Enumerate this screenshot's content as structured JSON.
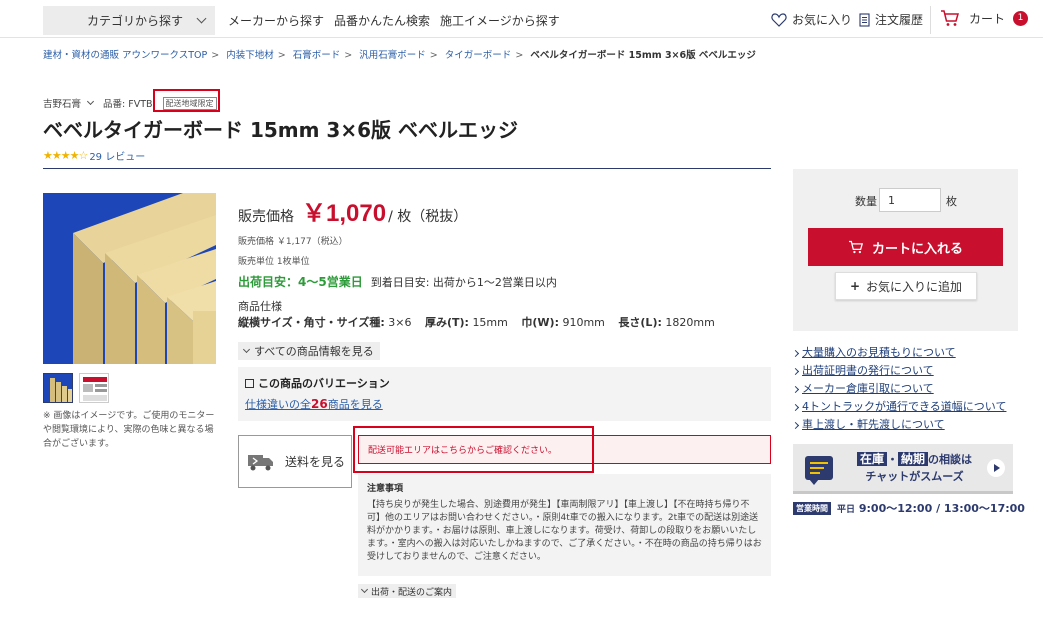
{
  "header": {
    "category_button": "カテゴリから探す",
    "nav": [
      "メーカーから探す",
      "品番かんたん検索",
      "施工イメージから探す"
    ],
    "favorites": "お気に入り",
    "order_history": "注文履歴",
    "cart": "カート",
    "cart_count": "1"
  },
  "breadcrumb": {
    "items": [
      "建材・資材の通販 アウンワークスTOP",
      "内装下地材",
      "石膏ボード",
      "汎用石膏ボード",
      "タイガーボード"
    ],
    "current": "ベベルタイガーボード 15mm 3×6版 ベベルエッジ"
  },
  "product": {
    "maker": "吉野石膏",
    "part_number": "品番: FVTB",
    "limit_tag": "配送地域限定",
    "title": "ベベルタイガーボード 15mm 3×6版 ベベルエッジ",
    "stars": "★★★★☆",
    "rating_value": 4.5,
    "reviews": "29 レビュー",
    "image_note": "※ 画像はイメージです。ご使用のモニターや閲覧環境により、実際の色味と異なる場合がございます。"
  },
  "price": {
    "label": "販売価格",
    "value": "￥1,070",
    "unit": "/ 枚（税抜）",
    "tax_included": "販売価格 ￥1,177（税込）",
    "sales_unit": "販売単位 1枚単位",
    "ship_estimate": "出荷目安：4〜5営業日",
    "arrival_estimate": "到着日目安: 出荷から1〜2営業日以内"
  },
  "spec": {
    "title": "商品仕様",
    "k1": "縦横サイズ・角寸・サイズ種:",
    "v1": "3×6",
    "k2": "厚み(T):",
    "v2": "15mm",
    "k3": "巾(W):",
    "v3": "910mm",
    "k4": "長さ(L):",
    "v4": "1820mm"
  },
  "all_info_button": "すべての商品情報を見る",
  "variation": {
    "title": "この商品のバリエーション",
    "link_prefix": "仕様違いの全",
    "link_count": "26",
    "link_suffix": "商品を見る"
  },
  "shipping_cost_button": "送料を見る",
  "area_notice": "配送可能エリアはこちらからご確認ください。",
  "caution": {
    "title": "注意事項",
    "text": "【持ち戻りが発生した場合、別途費用が発生】【車両制限アリ】【車上渡し】【不在時持ち帰り不可】他のエリアはお問い合わせください。・原則4t車での搬入になります。2t車での配送は別途送料がかかります。・お届けは原則、車上渡しになります。荷受け、荷卸しの段取りをお願いいたします。・室内への搬入は対応いたしかねますので、ご了承ください。・不在時の商品の持ち帰りはお受けしておりませんので、ご注意ください。"
  },
  "ship_guide_button": "出荷・配送のご案内",
  "cart_panel": {
    "qty_label": "数量",
    "qty_value": "1",
    "qty_unit": "枚",
    "add_to_cart": "カートに入れる",
    "add_favorite": "お気に入りに追加"
  },
  "side_links": [
    "大量購入のお見積もりについて",
    "出荷証明書の発行について",
    "メーカー倉庫引取について",
    "4トントラックが通行できる道幅について",
    "車上渡し・軒先渡しについて"
  ],
  "chat_banner": {
    "hl1": "在庫",
    "mid": "・",
    "hl2": "納期",
    "tail": "の相談は",
    "line2": "チャットがスムーズ"
  },
  "hours": {
    "tag": "営業時間",
    "weekday": "平日",
    "times": "9:00〜12:00 / 13:00〜17:00"
  },
  "colors": {
    "accent_red": "#c8102e",
    "link_blue": "#2b5fa8",
    "navy": "#2c3a6e",
    "ship_green": "#2e9b3a",
    "annotation_red": "#d9001b"
  }
}
